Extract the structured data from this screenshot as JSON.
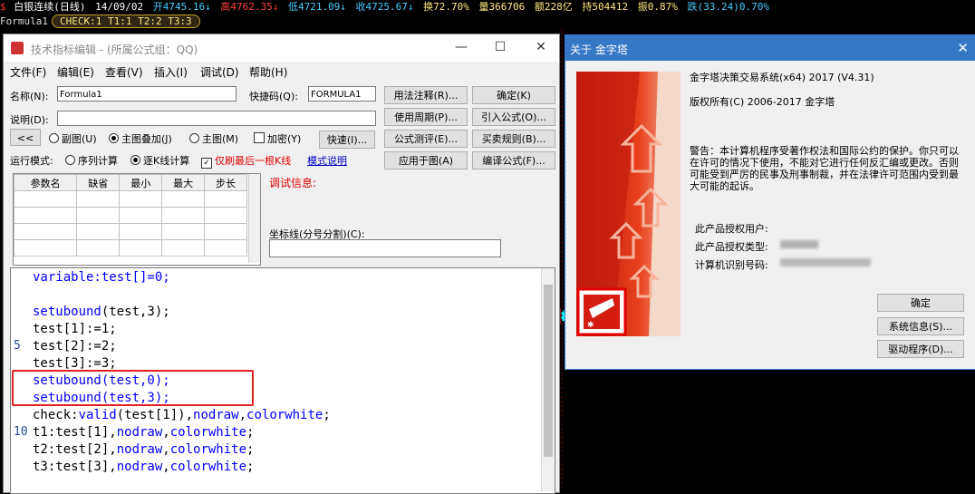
{
  "quote_bar": {
    "symbol": "白银连续(日线)",
    "date": "14/09/02",
    "open": "开4745.16↓",
    "high": "高4762.35↓",
    "low": "低4721.09↓",
    "close": "收4725.67↓",
    "turnover": "换72.70%",
    "volume": "量366706",
    "amount": "额228亿",
    "position": "持504412",
    "amplitude": "振0.87%",
    "change": "跌(33.24)0.70%"
  },
  "formula_bar": {
    "name": "Formula1",
    "values": "CHECK:1 T1:1 T2:2 T3:3"
  },
  "editor": {
    "title": "技术指标编辑 - (所属公式组：QQ)",
    "menu": [
      "文件(F)",
      "编辑(E)",
      "查看(V)",
      "插入(I)",
      "调试(D)",
      "帮助(H)"
    ],
    "name_label": "名称(N):",
    "name_value": "Formula1",
    "shortcut_label": "快捷码(Q):",
    "shortcut_value": "FORMULA1",
    "desc_label": "说明(D):",
    "collapse_btn": "<<",
    "radio_sub": "副图(U)",
    "radio_main_overlay": "主图叠加(J)",
    "radio_main": "主图(M)",
    "encrypt": "加密(Y)",
    "quick_btn": "快速(I)...",
    "run_mode_label": "运行模式:",
    "radio_seq": "序列计算",
    "radio_bar": "逐K线计算",
    "last_bar_only": "仅刷最后一根K线",
    "mode_help_link": "模式说明",
    "buttons": {
      "usage_note": "用法注释(R)...",
      "confirm": "确定(K)",
      "use_period": "使用周期(P)...",
      "import_formula": "引入公式(O)...",
      "formula_test": "公式测评(E)...",
      "trade_rules": "买卖规则(B)...",
      "apply_chart": "应用于图(A)",
      "compile": "编译公式(F)..."
    },
    "debug_label": "调试信息:",
    "coord_label": "坐标线(分号分割)(C):",
    "param_headers": [
      "参数名",
      "缺省",
      "最小",
      "最大",
      "步长"
    ],
    "line_numbers": [
      "5",
      "10"
    ],
    "code": {
      "l1": "variable:test[]=0;",
      "l2a": "setubound",
      "l2b": "(test,3);",
      "l3": "test[1]:=1;",
      "l4": "test[2]:=2;",
      "l5": "test[3]:=3;",
      "l6": "setubound(test,0);",
      "l7": "setubound(test,3);",
      "l8a": "check:",
      "l8b": "valid",
      "l8c": "(test[1]),",
      "l8d": "nodraw",
      "l8e": ",",
      "l8f": "colorwhite",
      "l8g": ";",
      "l9a": "t1:test[1],",
      "l10a": "t2:test[2],",
      "l11a": "t3:test[3],",
      "nodraw": "nodraw",
      "comma": ",",
      "colorwhite": "colorwhite",
      "semi": ";"
    }
  },
  "about": {
    "title": "关于 金字塔",
    "product": "金字塔决策交易系统(x64) 2017 (V4.31)",
    "copyright": "版权所有(C) 2006-2017 金字塔",
    "warning": "警告：本计算机程序受著作权法和国际公约的保护。你只可以在许可的情况下使用，不能对它进行任何反汇编或更改。否则可能受到严厉的民事及刑事制裁，并在法律许可范围内受到最大可能的起诉。",
    "licensed_user": "此产品授权用户:",
    "license_type": "此产品授权类型:",
    "machine_id": "计算机识别号码:",
    "ok": "确定",
    "sysinfo": "系统信息(S)...",
    "driver": "驱动程序(D)..."
  },
  "colors": {
    "up": "#ff3030",
    "down": "#00ffff",
    "accent": "#3478c6",
    "highlight_box": "#e02020"
  }
}
